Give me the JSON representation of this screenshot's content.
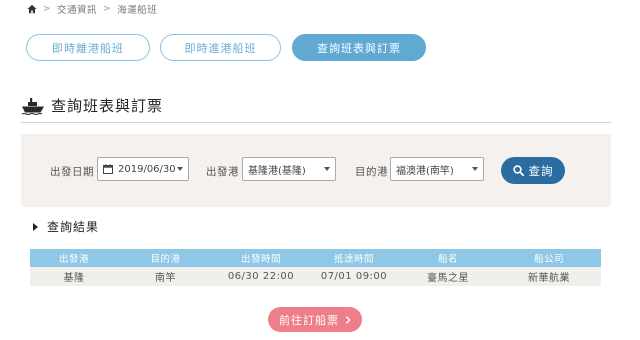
{
  "breadcrumb": {
    "items": [
      "交通資訊",
      "海運船班"
    ],
    "separator": ">"
  },
  "tabs": [
    {
      "label": "即時離港船班",
      "active": false
    },
    {
      "label": "即時進港船班",
      "active": false
    },
    {
      "label": "查詢班表與訂票",
      "active": true
    }
  ],
  "section": {
    "title": "查詢班表與訂票",
    "icon": "ship-icon"
  },
  "search": {
    "date_label": "出發日期",
    "date_value": "2019/06/30",
    "departure_label": "出發港",
    "departure_value": "基隆港(基隆)",
    "destination_label": "目的港",
    "destination_value": "福澳港(南竿)",
    "button_label": "查詢"
  },
  "results": {
    "title": "查詢結果",
    "columns": [
      "出發港",
      "目的港",
      "出發時間",
      "抵達時間",
      "船名",
      "船公司"
    ],
    "rows": [
      [
        "基隆",
        "南竿",
        "06/30 22:00",
        "07/01 09:00",
        "臺馬之星",
        "新華航業"
      ]
    ]
  },
  "book_button": {
    "label": "前往訂船票",
    "icon": "chevron-right-icon"
  },
  "colors": {
    "tab_border": "#8ec3df",
    "tab_active": "#5fa9d3",
    "search_button": "#2b6da0",
    "table_header": "#8ec8e6",
    "book_button": "#ee7f8a",
    "panel_bg": "#f4f1ee"
  }
}
